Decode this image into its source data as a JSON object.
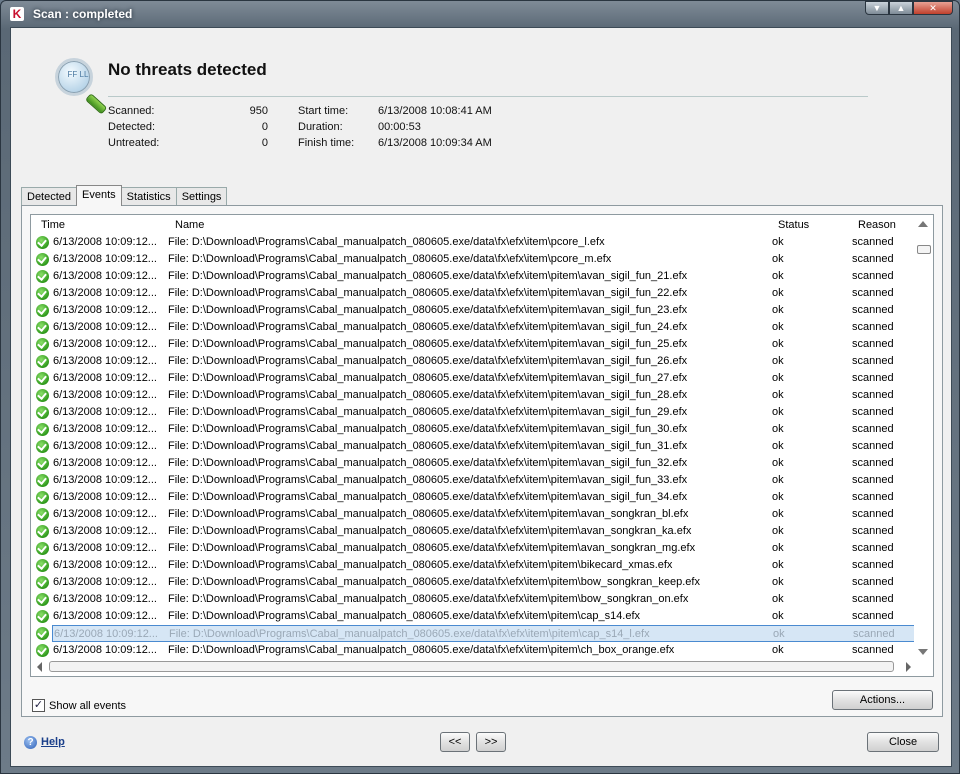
{
  "window": {
    "title": "Scan : completed",
    "logo": "K"
  },
  "header": {
    "headline": "No threats detected",
    "magnifier_text": "FF LL",
    "stats": {
      "scanned_label": "Scanned:",
      "scanned_value": "950",
      "detected_label": "Detected:",
      "detected_value": "0",
      "untreated_label": "Untreated:",
      "untreated_value": "0",
      "start_label": "Start time:",
      "start_value": "6/13/2008 10:08:41 AM",
      "duration_label": "Duration:",
      "duration_value": "00:00:53",
      "finish_label": "Finish time:",
      "finish_value": "6/13/2008 10:09:34 AM"
    }
  },
  "tabs": [
    "Detected",
    "Events",
    "Statistics",
    "Settings"
  ],
  "active_tab": "Events",
  "events": {
    "columns": {
      "time": "Time",
      "name": "Name",
      "status": "Status",
      "reason": "Reason"
    },
    "selected_index": 23,
    "rows": [
      {
        "time": "6/13/2008 10:09:12...",
        "name": "File: D:\\Download\\Programs\\Cabal_manualpatch_080605.exe/data\\fx\\efx\\item\\pcore_l.efx",
        "status": "ok",
        "reason": "scanned"
      },
      {
        "time": "6/13/2008 10:09:12...",
        "name": "File: D:\\Download\\Programs\\Cabal_manualpatch_080605.exe/data\\fx\\efx\\item\\pcore_m.efx",
        "status": "ok",
        "reason": "scanned"
      },
      {
        "time": "6/13/2008 10:09:12...",
        "name": "File: D:\\Download\\Programs\\Cabal_manualpatch_080605.exe/data\\fx\\efx\\item\\pitem\\avan_sigil_fun_21.efx",
        "status": "ok",
        "reason": "scanned"
      },
      {
        "time": "6/13/2008 10:09:12...",
        "name": "File: D:\\Download\\Programs\\Cabal_manualpatch_080605.exe/data\\fx\\efx\\item\\pitem\\avan_sigil_fun_22.efx",
        "status": "ok",
        "reason": "scanned"
      },
      {
        "time": "6/13/2008 10:09:12...",
        "name": "File: D:\\Download\\Programs\\Cabal_manualpatch_080605.exe/data\\fx\\efx\\item\\pitem\\avan_sigil_fun_23.efx",
        "status": "ok",
        "reason": "scanned"
      },
      {
        "time": "6/13/2008 10:09:12...",
        "name": "File: D:\\Download\\Programs\\Cabal_manualpatch_080605.exe/data\\fx\\efx\\item\\pitem\\avan_sigil_fun_24.efx",
        "status": "ok",
        "reason": "scanned"
      },
      {
        "time": "6/13/2008 10:09:12...",
        "name": "File: D:\\Download\\Programs\\Cabal_manualpatch_080605.exe/data\\fx\\efx\\item\\pitem\\avan_sigil_fun_25.efx",
        "status": "ok",
        "reason": "scanned"
      },
      {
        "time": "6/13/2008 10:09:12...",
        "name": "File: D:\\Download\\Programs\\Cabal_manualpatch_080605.exe/data\\fx\\efx\\item\\pitem\\avan_sigil_fun_26.efx",
        "status": "ok",
        "reason": "scanned"
      },
      {
        "time": "6/13/2008 10:09:12...",
        "name": "File: D:\\Download\\Programs\\Cabal_manualpatch_080605.exe/data\\fx\\efx\\item\\pitem\\avan_sigil_fun_27.efx",
        "status": "ok",
        "reason": "scanned"
      },
      {
        "time": "6/13/2008 10:09:12...",
        "name": "File: D:\\Download\\Programs\\Cabal_manualpatch_080605.exe/data\\fx\\efx\\item\\pitem\\avan_sigil_fun_28.efx",
        "status": "ok",
        "reason": "scanned"
      },
      {
        "time": "6/13/2008 10:09:12...",
        "name": "File: D:\\Download\\Programs\\Cabal_manualpatch_080605.exe/data\\fx\\efx\\item\\pitem\\avan_sigil_fun_29.efx",
        "status": "ok",
        "reason": "scanned"
      },
      {
        "time": "6/13/2008 10:09:12...",
        "name": "File: D:\\Download\\Programs\\Cabal_manualpatch_080605.exe/data\\fx\\efx\\item\\pitem\\avan_sigil_fun_30.efx",
        "status": "ok",
        "reason": "scanned"
      },
      {
        "time": "6/13/2008 10:09:12...",
        "name": "File: D:\\Download\\Programs\\Cabal_manualpatch_080605.exe/data\\fx\\efx\\item\\pitem\\avan_sigil_fun_31.efx",
        "status": "ok",
        "reason": "scanned"
      },
      {
        "time": "6/13/2008 10:09:12...",
        "name": "File: D:\\Download\\Programs\\Cabal_manualpatch_080605.exe/data\\fx\\efx\\item\\pitem\\avan_sigil_fun_32.efx",
        "status": "ok",
        "reason": "scanned"
      },
      {
        "time": "6/13/2008 10:09:12...",
        "name": "File: D:\\Download\\Programs\\Cabal_manualpatch_080605.exe/data\\fx\\efx\\item\\pitem\\avan_sigil_fun_33.efx",
        "status": "ok",
        "reason": "scanned"
      },
      {
        "time": "6/13/2008 10:09:12...",
        "name": "File: D:\\Download\\Programs\\Cabal_manualpatch_080605.exe/data\\fx\\efx\\item\\pitem\\avan_sigil_fun_34.efx",
        "status": "ok",
        "reason": "scanned"
      },
      {
        "time": "6/13/2008 10:09:12...",
        "name": "File: D:\\Download\\Programs\\Cabal_manualpatch_080605.exe/data\\fx\\efx\\item\\pitem\\avan_songkran_bl.efx",
        "status": "ok",
        "reason": "scanned"
      },
      {
        "time": "6/13/2008 10:09:12...",
        "name": "File: D:\\Download\\Programs\\Cabal_manualpatch_080605.exe/data\\fx\\efx\\item\\pitem\\avan_songkran_ka.efx",
        "status": "ok",
        "reason": "scanned"
      },
      {
        "time": "6/13/2008 10:09:12...",
        "name": "File: D:\\Download\\Programs\\Cabal_manualpatch_080605.exe/data\\fx\\efx\\item\\pitem\\avan_songkran_mg.efx",
        "status": "ok",
        "reason": "scanned"
      },
      {
        "time": "6/13/2008 10:09:12...",
        "name": "File: D:\\Download\\Programs\\Cabal_manualpatch_080605.exe/data\\fx\\efx\\item\\pitem\\bikecard_xmas.efx",
        "status": "ok",
        "reason": "scanned"
      },
      {
        "time": "6/13/2008 10:09:12...",
        "name": "File: D:\\Download\\Programs\\Cabal_manualpatch_080605.exe/data\\fx\\efx\\item\\pitem\\bow_songkran_keep.efx",
        "status": "ok",
        "reason": "scanned"
      },
      {
        "time": "6/13/2008 10:09:12...",
        "name": "File: D:\\Download\\Programs\\Cabal_manualpatch_080605.exe/data\\fx\\efx\\item\\pitem\\bow_songkran_on.efx",
        "status": "ok",
        "reason": "scanned"
      },
      {
        "time": "6/13/2008 10:09:12...",
        "name": "File: D:\\Download\\Programs\\Cabal_manualpatch_080605.exe/data\\fx\\efx\\item\\pitem\\cap_s14.efx",
        "status": "ok",
        "reason": "scanned"
      },
      {
        "time": "6/13/2008 10:09:12...",
        "name": "File: D:\\Download\\Programs\\Cabal_manualpatch_080605.exe/data\\fx\\efx\\item\\pitem\\cap_s14_l.efx",
        "status": "ok",
        "reason": "scanned"
      },
      {
        "time": "6/13/2008 10:09:12...",
        "name": "File: D:\\Download\\Programs\\Cabal_manualpatch_080605.exe/data\\fx\\efx\\item\\pitem\\ch_box_orange.efx",
        "status": "ok",
        "reason": "scanned"
      }
    ]
  },
  "show_all_events": {
    "label": "Show all events",
    "checked": true
  },
  "buttons": {
    "actions": "Actions...",
    "prev": "<<",
    "next": ">>",
    "close": "Close"
  },
  "help": {
    "icon": "?",
    "label": "Help"
  },
  "colors": {
    "ok_green": "#2f9a1c",
    "selection": "#d6e6f5",
    "headline": "#111111"
  }
}
